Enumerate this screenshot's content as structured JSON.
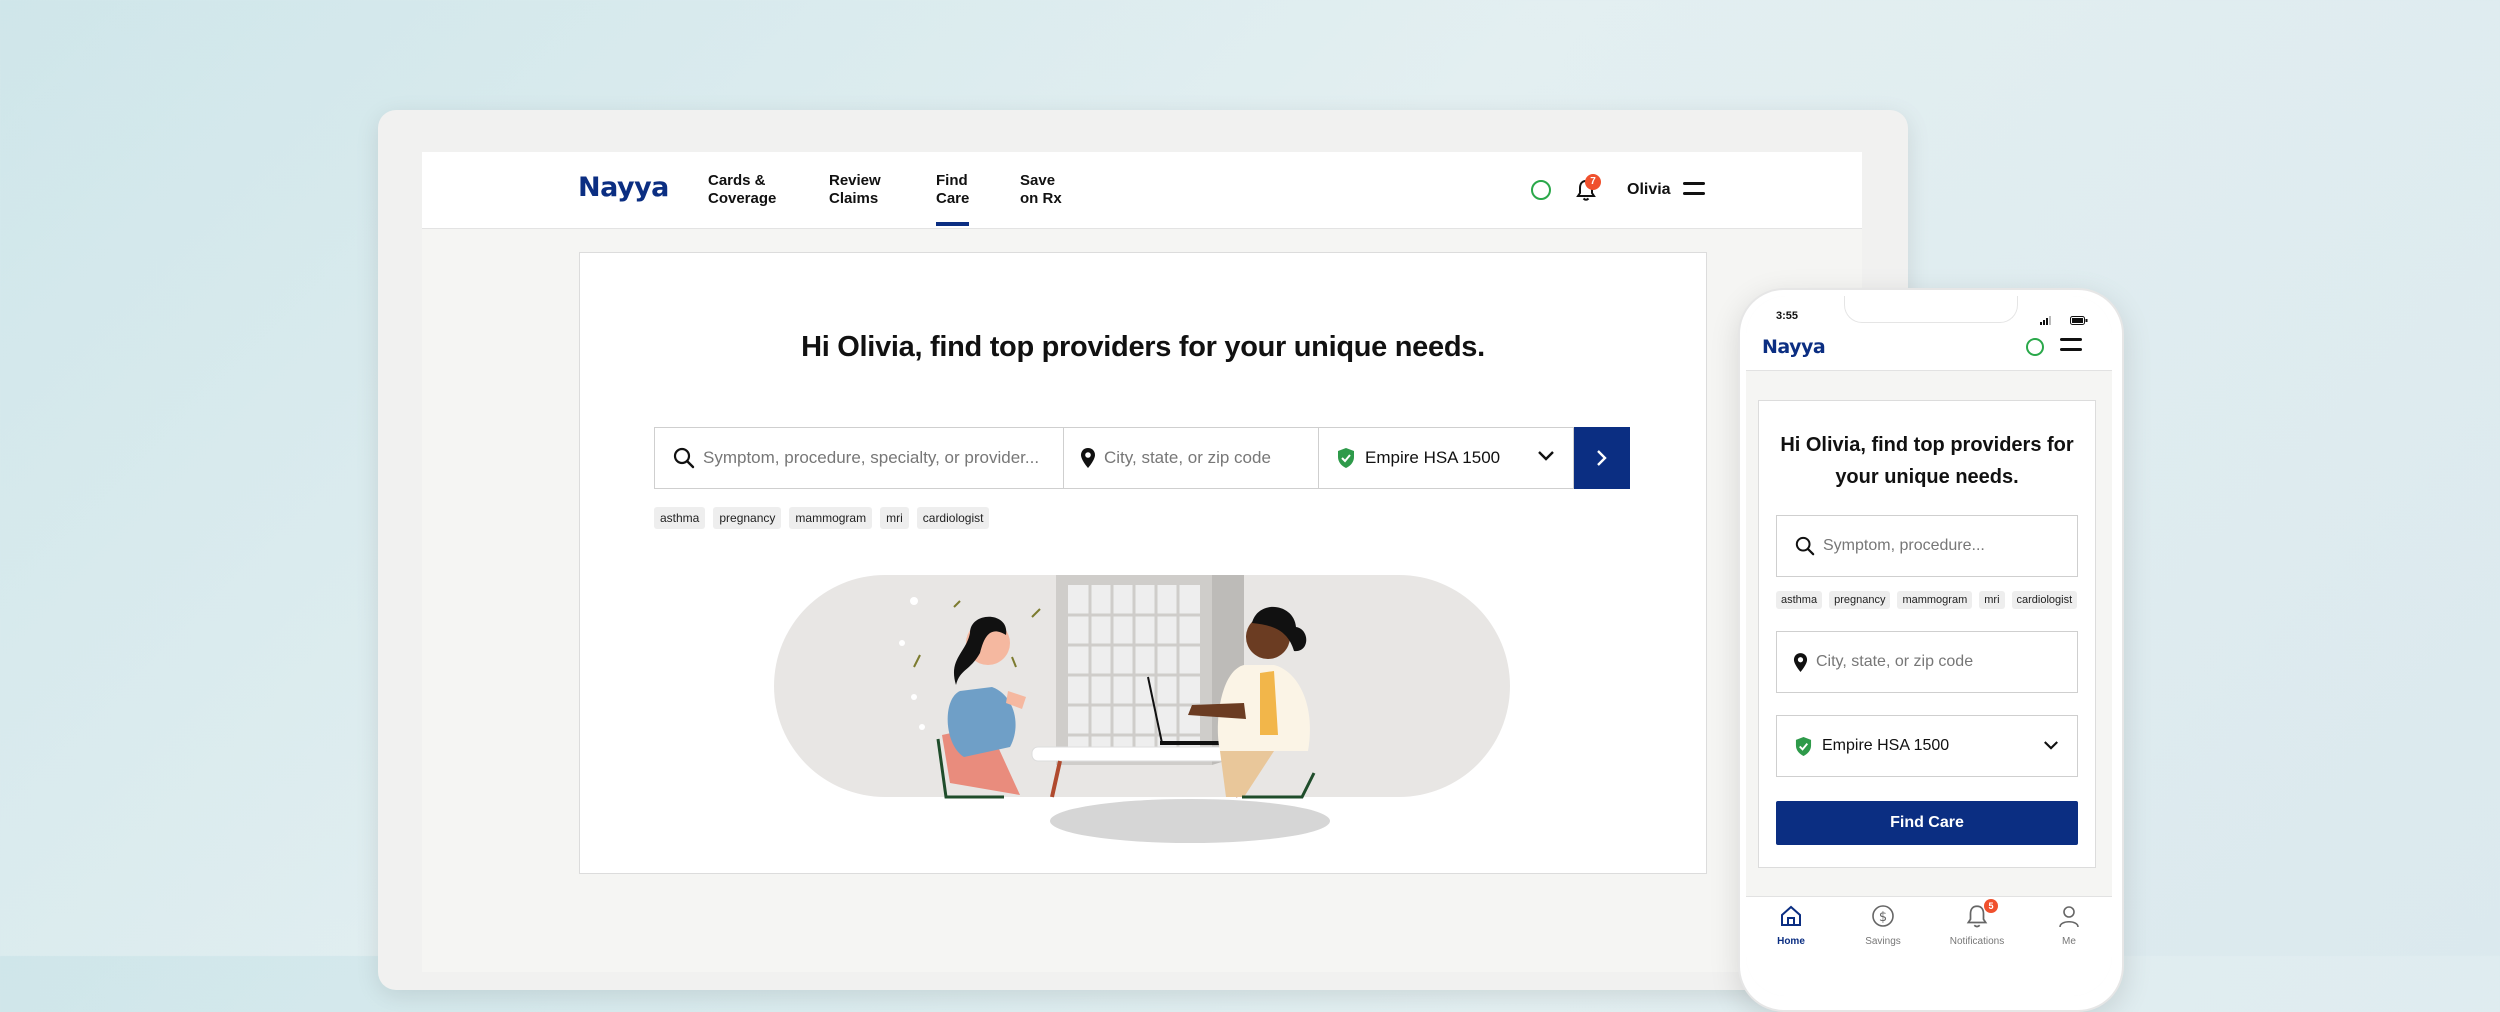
{
  "brand": {
    "name": "Nayya",
    "color": "#0b2e82"
  },
  "nav": {
    "items": [
      {
        "label": "Cards &\nCoverage",
        "active": false
      },
      {
        "label": "Review\nClaims",
        "active": false
      },
      {
        "label": "Find\nCare",
        "active": true
      },
      {
        "label": "Save\non Rx",
        "active": false
      }
    ],
    "notification_count": "7",
    "user_name": "Olivia"
  },
  "find_care": {
    "headline": "Hi Olivia, find top providers for your unique needs.",
    "search_placeholder": "Symptom, procedure, specialty, or provider...",
    "location_placeholder": "City, state, or zip code",
    "plan": "Empire HSA 1500",
    "tags": [
      "asthma",
      "pregnancy",
      "mammogram",
      "mri",
      "cardiologist"
    ]
  },
  "mobile": {
    "time": "3:55",
    "headline": "Hi Olivia, find top providers for your unique needs.",
    "search_placeholder": "Symptom, procedure...",
    "location_placeholder": "City, state, or zip code",
    "plan": "Empire HSA 1500",
    "button": "Find Care",
    "tabs": [
      {
        "label": "Home",
        "icon": "home-icon",
        "active": true
      },
      {
        "label": "Savings",
        "icon": "dollar-icon",
        "active": false
      },
      {
        "label": "Notifications",
        "icon": "bell-icon",
        "active": false
      },
      {
        "label": "Me",
        "icon": "person-icon",
        "active": false
      }
    ],
    "notification_count": "5"
  }
}
